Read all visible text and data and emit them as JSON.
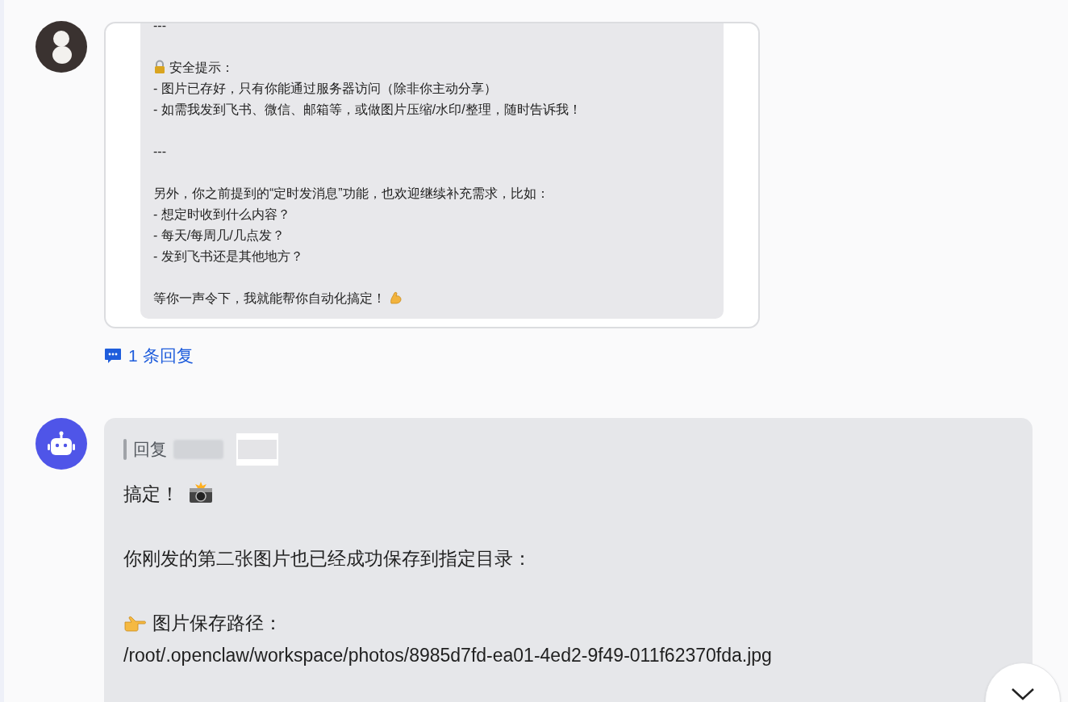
{
  "quoted_message": {
    "paragraphs": [
      {
        "kind": "text",
        "lines": [
          "---"
        ]
      },
      {
        "kind": "lock",
        "lines": [
          "安全提示：",
          "- 图片已存好，只有你能通过服务器访问（除非你主动分享）",
          "- 如需我发到飞书、微信、邮箱等，或做图片压缩/水印/整理，随时告诉我！"
        ]
      },
      {
        "kind": "text",
        "lines": [
          "---"
        ]
      },
      {
        "kind": "text",
        "lines": [
          "另外，你之前提到的“定时发消息”功能，也欢迎继续补充需求，比如：",
          "- 想定时收到什么内容？",
          "- 每天/每周几/几点发？",
          "- 发到飞书还是其他地方？"
        ]
      },
      {
        "kind": "muscle",
        "lines": [
          "等你一声令下，我就能帮你自动化搞定！"
        ]
      }
    ]
  },
  "reply_link": "1 条回复",
  "bot_message": {
    "reply_label": "回复",
    "paragraphs": [
      {
        "kind": "camera",
        "lines": [
          "搞定！"
        ]
      },
      {
        "kind": "text",
        "lines": [
          "你刚发的第二张图片也已经成功保存到指定目录："
        ]
      },
      {
        "kind": "pointer",
        "lines": [
          "图片保存路径：",
          "/root/.openclaw/workspace/photos/8985d7fd-ea01-4ed2-9f49-011f62370fda.jpg"
        ]
      }
    ]
  }
}
